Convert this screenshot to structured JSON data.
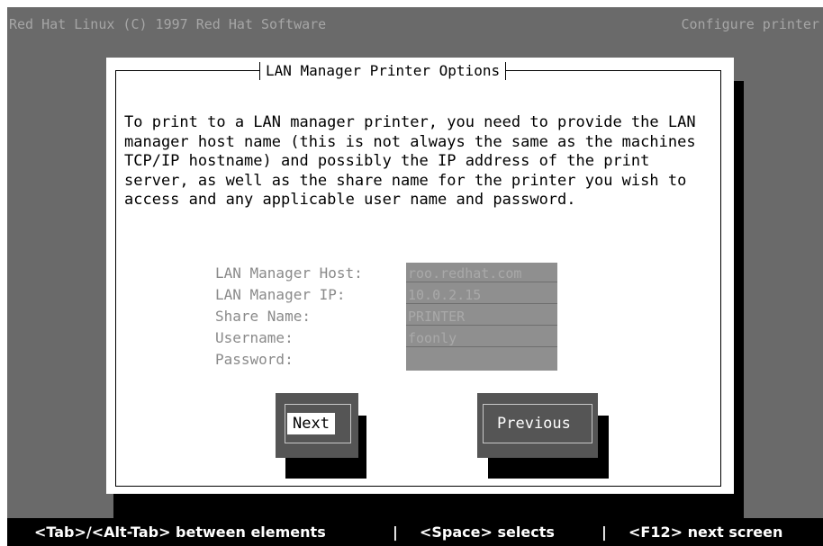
{
  "header": {
    "left_title": "Red Hat Linux (C) 1997 Red Hat Software",
    "right_title": "Configure printer"
  },
  "dialog": {
    "title": "LAN Manager Printer Options",
    "intro": "To print to a LAN manager printer, you need to provide the LAN manager host name (this is not always the same as the machines TCP/IP hostname) and possibly the IP address of the print server, as well as the share name for the printer you wish to access and any applicable user name and password.",
    "fields": [
      {
        "label": "LAN Manager Host:",
        "value": "roo.redhat.com"
      },
      {
        "label": "LAN Manager IP:",
        "value": "10.0.2.15"
      },
      {
        "label": "Share Name:",
        "value": "PRINTER"
      },
      {
        "label": "Username:",
        "value": "foonly"
      },
      {
        "label": "Password:",
        "value": ""
      }
    ],
    "buttons": {
      "next": "Next",
      "previous": "Previous"
    }
  },
  "status_bar": {
    "hint_tab": "<Tab>/<Alt-Tab> between elements",
    "separator": "|",
    "hint_space": "<Space> selects",
    "hint_f12": "<F12> next screen"
  },
  "colors": {
    "background": "#6a6a6a",
    "dialog": "#ffffff",
    "field": "#8f8f8f",
    "button": "#555555",
    "status_bar": "#000000"
  }
}
